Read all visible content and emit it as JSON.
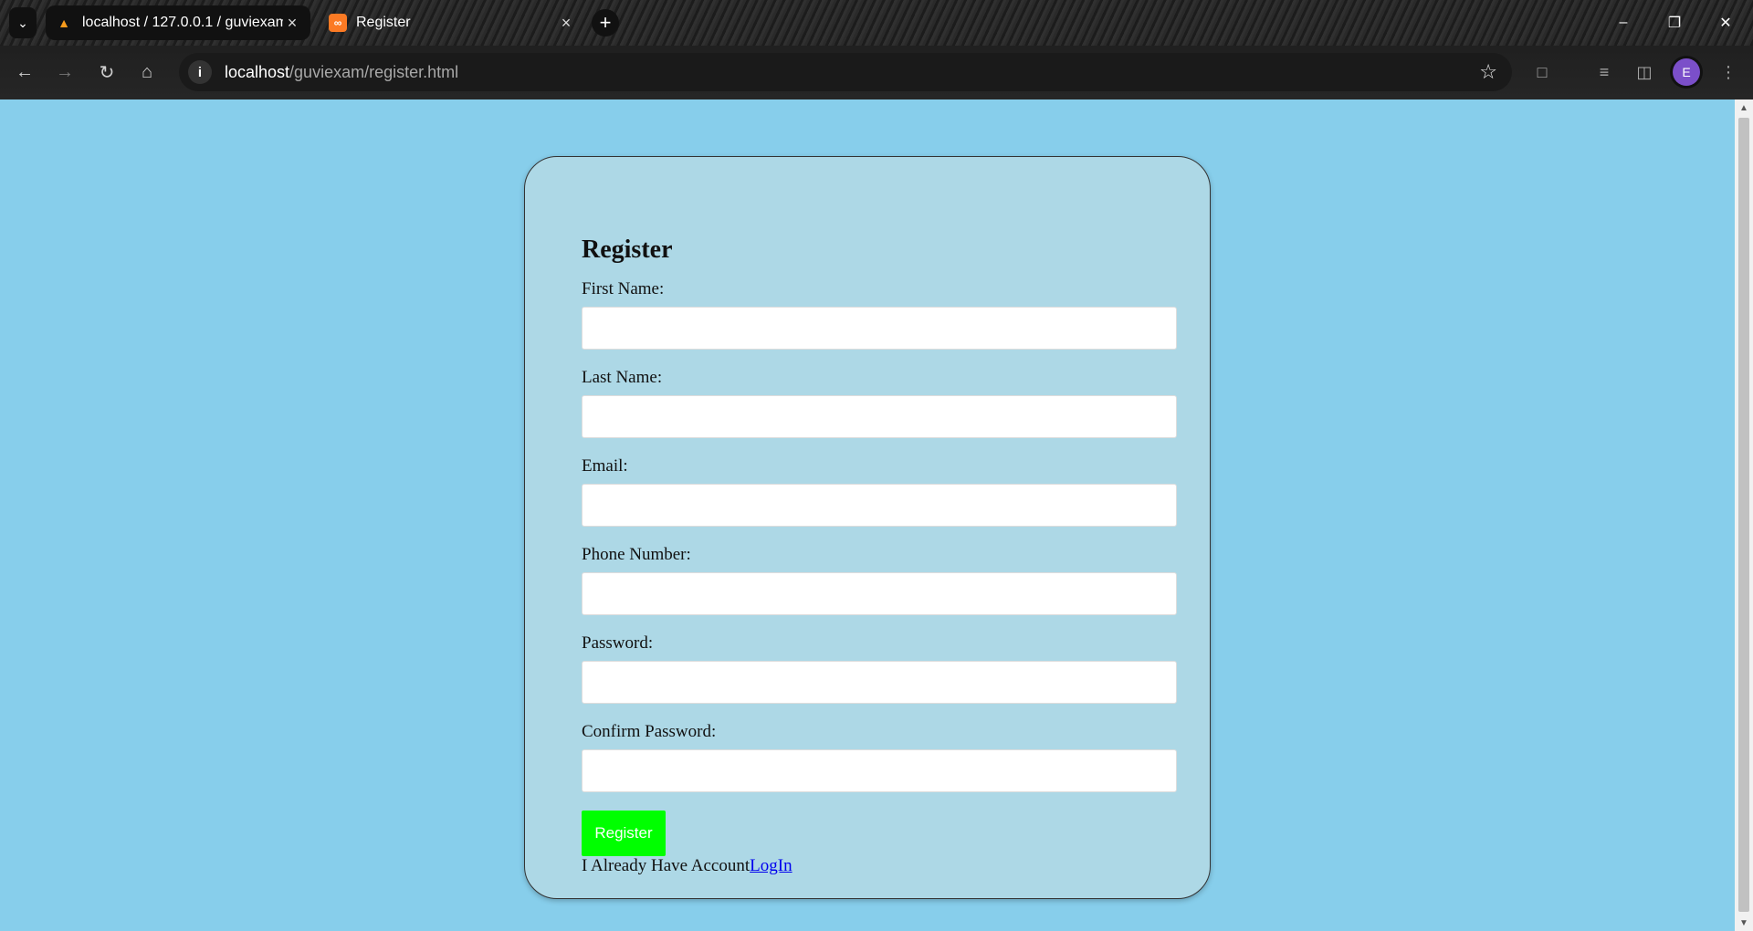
{
  "browser": {
    "tabs": [
      {
        "title": "localhost / 127.0.0.1 / guviexam",
        "active": true
      },
      {
        "title": "Register",
        "active": false
      }
    ],
    "url_host": "localhost",
    "url_path": "/guviexam/register.html",
    "profile_initial": "E"
  },
  "form": {
    "heading": "Register",
    "fields": [
      {
        "label": "First Name:",
        "value": ""
      },
      {
        "label": "Last Name:",
        "value": ""
      },
      {
        "label": "Email:",
        "value": ""
      },
      {
        "label": "Phone Number:",
        "value": ""
      },
      {
        "label": "Password:",
        "value": ""
      },
      {
        "label": "Confirm Password:",
        "value": ""
      }
    ],
    "submit_label": "Register",
    "footer_text": "I Already Have Account",
    "login_link": "LogIn"
  },
  "colors": {
    "page_bg": "#87ceeb",
    "card_bg": "#add8e6",
    "button_bg": "#00ff00"
  }
}
